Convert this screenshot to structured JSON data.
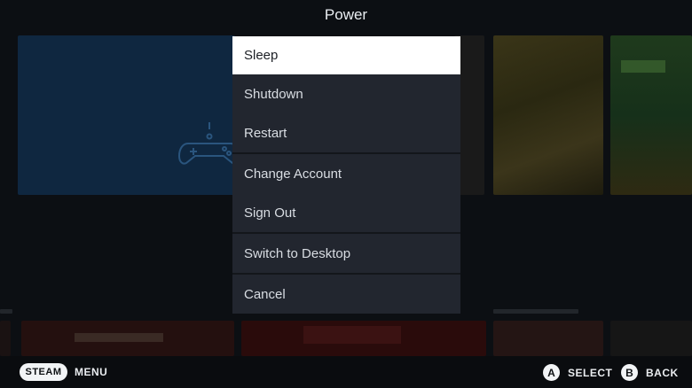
{
  "dialog": {
    "title": "Power",
    "items": [
      {
        "label": "Sleep",
        "selected": true
      },
      {
        "label": "Shutdown"
      },
      {
        "label": "Restart"
      },
      {
        "label": "Change Account"
      },
      {
        "label": "Sign Out"
      },
      {
        "label": "Switch to Desktop"
      },
      {
        "label": "Cancel"
      }
    ]
  },
  "footer": {
    "steam_button": "STEAM",
    "steam_action": "MENU",
    "a_button": "A",
    "a_action": "SELECT",
    "b_button": "B",
    "b_action": "BACK"
  },
  "colors": {
    "menu_bg": "#22262f",
    "selected_bg": "#ffffff",
    "selected_text": "#1d2026",
    "item_text": "#d9dde3"
  }
}
